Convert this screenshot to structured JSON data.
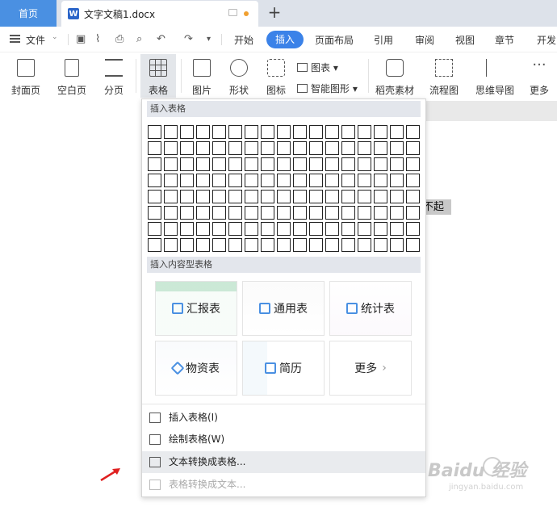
{
  "titlebar": {
    "home_tab": "首页",
    "doc_tab_title": "文字文稿1.docx",
    "new_tab_symbol": "+"
  },
  "menubar": {
    "file_label": "文件",
    "tabs": [
      "开始",
      "插入",
      "页面布局",
      "引用",
      "审阅",
      "视图",
      "章节",
      "开发"
    ],
    "active_tab": "插入"
  },
  "ribbon": {
    "buttons": [
      {
        "label": "封面页",
        "icon": "cover-page-icon"
      },
      {
        "label": "空白页",
        "icon": "blank-page-icon"
      },
      {
        "label": "分页",
        "icon": "page-break-icon"
      },
      {
        "label": "表格",
        "icon": "table-icon"
      },
      {
        "label": "图片",
        "icon": "picture-icon"
      },
      {
        "label": "形状",
        "icon": "shape-icon"
      },
      {
        "label": "图标",
        "icon": "icons-icon"
      },
      {
        "label": "稻壳素材",
        "icon": "docer-material-icon"
      },
      {
        "label": "流程图",
        "icon": "flowchart-icon"
      },
      {
        "label": "思维导图",
        "icon": "mindmap-icon"
      },
      {
        "label": "更多",
        "icon": "more-icon"
      }
    ],
    "chart_label": "图表",
    "smart_shape_label": "智能图形"
  },
  "document": {
    "selected_text": "不起",
    "watermark": "Baidu 经验",
    "watermark_sub": "jingyan.baidu.com"
  },
  "panel": {
    "insert_table_heading": "插入表格",
    "grid_rows": 8,
    "grid_cols": 17,
    "content_table_heading": "插入内容型表格",
    "cards": [
      "汇报表",
      "通用表",
      "统计表",
      "物资表",
      "简历",
      "更多"
    ],
    "menu_items": [
      {
        "label": "插入表格(I)",
        "icon": "insert-table-icon",
        "enabled": true
      },
      {
        "label": "绘制表格(W)",
        "icon": "draw-table-icon",
        "enabled": true
      },
      {
        "label": "文本转换成表格...",
        "icon": "text-to-table-icon",
        "enabled": true
      },
      {
        "label": "表格转换成文本...",
        "icon": "table-to-text-icon",
        "enabled": false
      }
    ]
  },
  "colors": {
    "accent": "#3b82e8",
    "home_tab": "#4a90e2",
    "arrow": "#e02020"
  }
}
